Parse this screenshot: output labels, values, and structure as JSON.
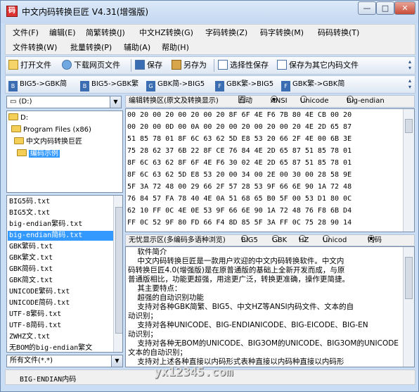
{
  "window": {
    "title": "中文内码转换巨匠 V4.31(增强版)",
    "buttons": {
      "min": "—",
      "max": "□",
      "close": "✕"
    }
  },
  "menu": {
    "row1": [
      "文件(F)",
      "编辑(E)",
      "简繁转换(J)",
      "中文HZ转换(G)",
      "字码转换(Z)",
      "码字转换(M)",
      "码码转换(T)"
    ],
    "row2": [
      "文件转换(W)",
      "批量转换(P)",
      "辅助(A)",
      "帮助(H)"
    ]
  },
  "toolbar": {
    "open": "打开文件",
    "download": "下载网页文件",
    "save": "保存",
    "save_as": "另存为",
    "selective_save": "选择性保存",
    "save_other": "保存为其它内码文件"
  },
  "convert_bar": {
    "items": [
      "BIG5->GBK简",
      "BIG5->GBK繁",
      "GBK简->BIG5",
      "GBK繁->BIG5",
      "GBK繁->GBK简"
    ]
  },
  "left": {
    "drive": "(D:)",
    "tree": [
      "D:",
      "Program Files (x86)",
      "中文内码转换巨匠",
      "编码示例"
    ],
    "files": [
      "BIG5码.txt",
      "BIG5文.txt",
      "big-endian繁码.txt",
      "big-endian简码.txt",
      "GBK繁码.txt",
      "GBK繁文.txt",
      "GBK简码.txt",
      "GBK简文.txt",
      "UNICODE繁码.txt",
      "UNICODE简码.txt",
      "UTF-8繁码.txt",
      "UTF-8简码.txt",
      "ZWHZ文.txt",
      "无BOM的big-endian繁文"
    ],
    "filter": "所有文件(*.*)"
  },
  "hex": {
    "header": "编辑转换区(原文及转换显示)",
    "auto_label": "自动",
    "options": [
      "ANSI",
      "Unicode",
      "Big-endian"
    ],
    "lines": [
      "00 20 00 20 00 20 00 20 8F 6F 4E F6 7B 80 4E CB 00 20",
      "00 20 00 0D 00 0A 00 20 00 20 00 20 00 20 4E 2D 65 87",
      "51 85 78 01 8F 6C 63 62 5D E8 53 20 66 2F 4E 00 6B 3E",
      "75 28 62 37 6B 22 8F CE 76 84 4E 2D 65 87 51 85 78 01",
      "8F 6C 63 62 8F 6F 4E F6 30 02 4E 2D 65 87 51 85 78 01",
      "8F 6C 63 62 5D E8 53 20 00 34 00 2E 00 30 00 28 58 9E",
      "5F 3A 72 48 00 29 66 2F 57 28 53 9F 66 6E 90 1A 72 48",
      "76 84 57 FA 78 40 4E 0A 51 68 65 B0 5F 00 53 D1 80 0C",
      "62 10 FF 0C 4E 0E 53 9F 66 6E 90 1A 72 48 76 F8 6B D4",
      "FF 0C 52 9F 80 FD 66 F4 8D 85 5F 3A FF 0C 75 28 90 14"
    ]
  },
  "text": {
    "header": "无忧显示区(多编码多语种浏览)",
    "options": [
      "BIG5",
      "GBK",
      "HZ",
      "Unicod",
      "内码"
    ],
    "lines": [
      "    软件简介",
      "    中文内码转换巨匠是一款用户欢迎的中文内码转换软件。中文内",
      "码转换巨匠4.0(增强版)是在原普通版的基础上全新开发而成，与原",
      "普通版相比，功能更超强，用途更广泛，转换更准确，操作更简捷。",
      "    其主要特点：",
      "    超强的自动识别功能",
      "    支持对各种GBK简繁、BIG5、中文HZ等ANSI内码文件、文本的自",
      "动识别；",
      "    支持对各种UNICODE、BIG-ENDIANICODE、BIG-EICODE、BIG-EN",
      "动识别；",
      "    支持对各种无BOM的UNICODE、BIG3OM的UNICODE、BIG3OM的UNICODE",
      "文本的自动识别；",
      "    支持对上述各种直接以内码形式表种直接以内码种直接以内码形"
    ]
  },
  "status": {
    "text": "BIG-ENDIAN内码"
  },
  "watermark": "yx12345.com"
}
